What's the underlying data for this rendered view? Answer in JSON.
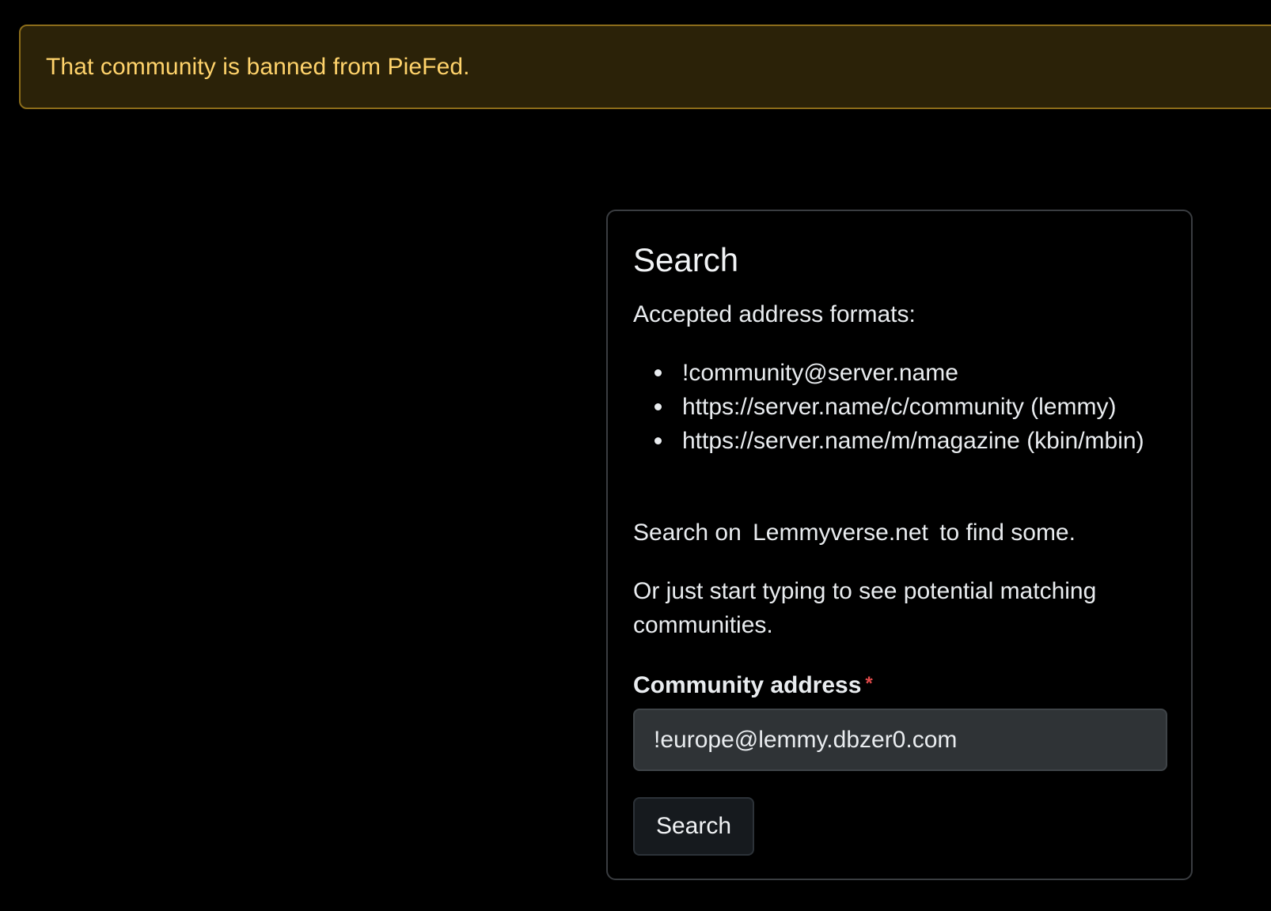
{
  "alert": {
    "message": "That community is banned from PieFed."
  },
  "search_card": {
    "title": "Search",
    "formats_label": "Accepted address formats:",
    "formats": [
      "!community@server.name",
      "https://server.name/c/community (lemmy)",
      "https://server.name/m/magazine (kbin/mbin)"
    ],
    "lemmy_prefix": "Search on",
    "lemmy_link": "Lemmyverse.net",
    "lemmy_suffix": "to find some.",
    "typing_hint": "Or just start typing to see potential matching communities.",
    "field_label": "Community address",
    "required_marker": "*",
    "field_value": "!europe@lemmy.dbzer0.com",
    "button_label": "Search"
  },
  "colors": {
    "alert_background": "#2b2208",
    "alert_text": "#ffd36b",
    "required": "#e04a4a",
    "input_background": "#2f3336"
  }
}
